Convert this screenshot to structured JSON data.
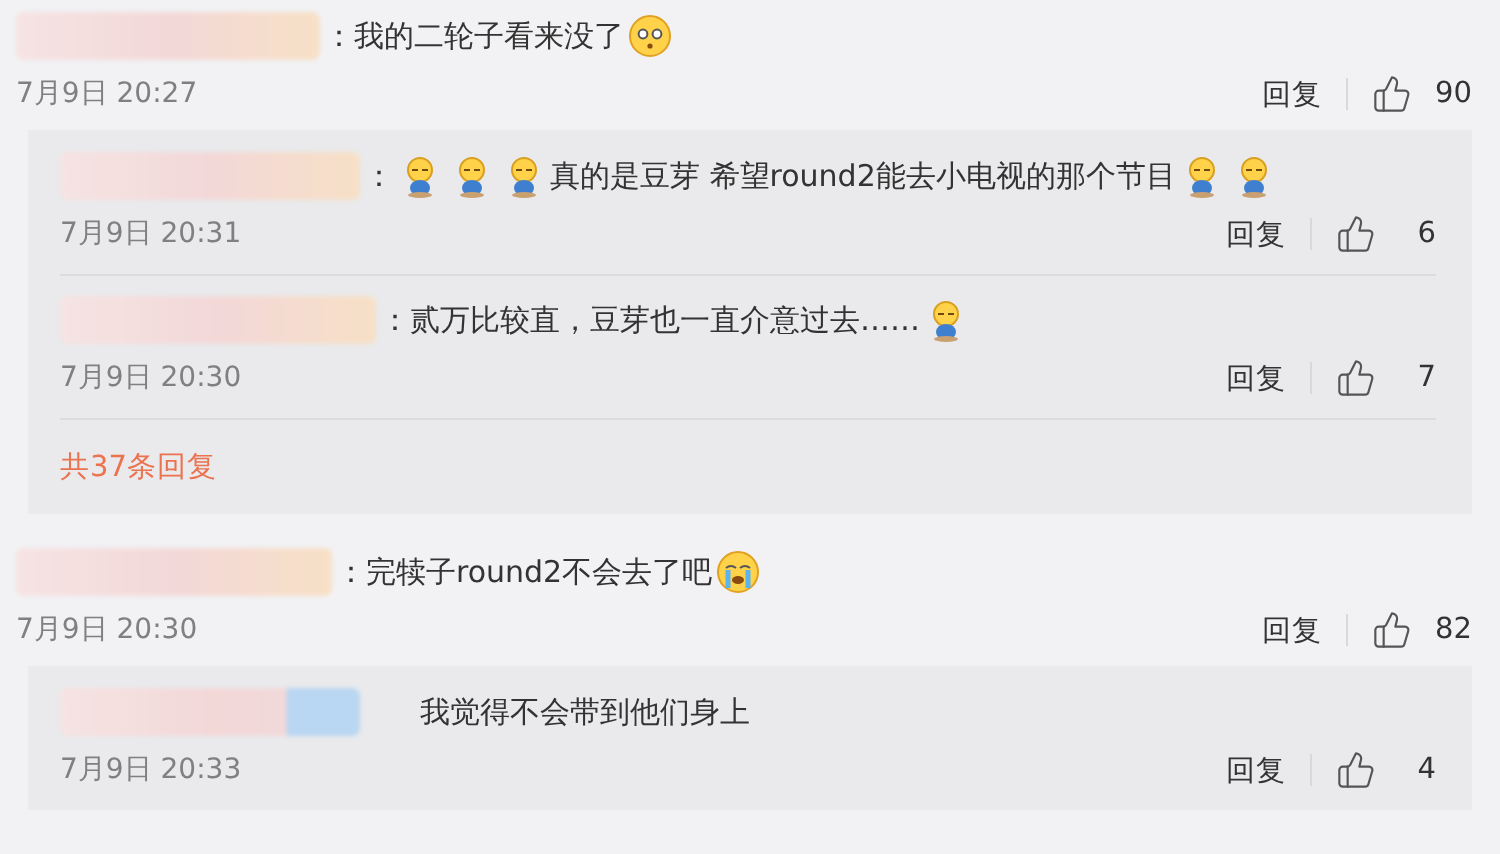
{
  "comments": [
    {
      "segments": [
        {
          "kind": "text",
          "text": "：我的二轮子看来没了"
        },
        {
          "kind": "flushed"
        }
      ],
      "time": "7月9日 20:27",
      "reply_label": "回复",
      "likes": "90",
      "replies": [
        {
          "segments": [
            {
              "kind": "text",
              "text": "："
            },
            {
              "kind": "sleepy"
            },
            {
              "kind": "sleepy"
            },
            {
              "kind": "sleepy"
            },
            {
              "kind": "text",
              "text": "真的是豆芽 希望round2能去小电视的那个节目"
            },
            {
              "kind": "sleepy"
            },
            {
              "kind": "sleepy"
            }
          ],
          "time": "7月9日 20:31",
          "reply_label": "回复",
          "likes": "6"
        },
        {
          "segments": [
            {
              "kind": "text",
              "text": "：贰万比较直，豆芽也一直介意过去……"
            },
            {
              "kind": "sleepy"
            }
          ],
          "time": "7月9日 20:30",
          "reply_label": "回复",
          "likes": "7"
        }
      ],
      "more_replies": "共37条回复"
    },
    {
      "segments": [
        {
          "kind": "text",
          "text": "：完犊子round2不会去了吧"
        },
        {
          "kind": "crying"
        }
      ],
      "time": "7月9日 20:30",
      "reply_label": "回复",
      "likes": "82",
      "replies": [
        {
          "segments": [
            {
              "kind": "text",
              "text": "我觉得不会带到他们身上"
            }
          ],
          "time": "7月9日 20:33",
          "reply_label": "回复",
          "likes": "4"
        }
      ]
    }
  ]
}
